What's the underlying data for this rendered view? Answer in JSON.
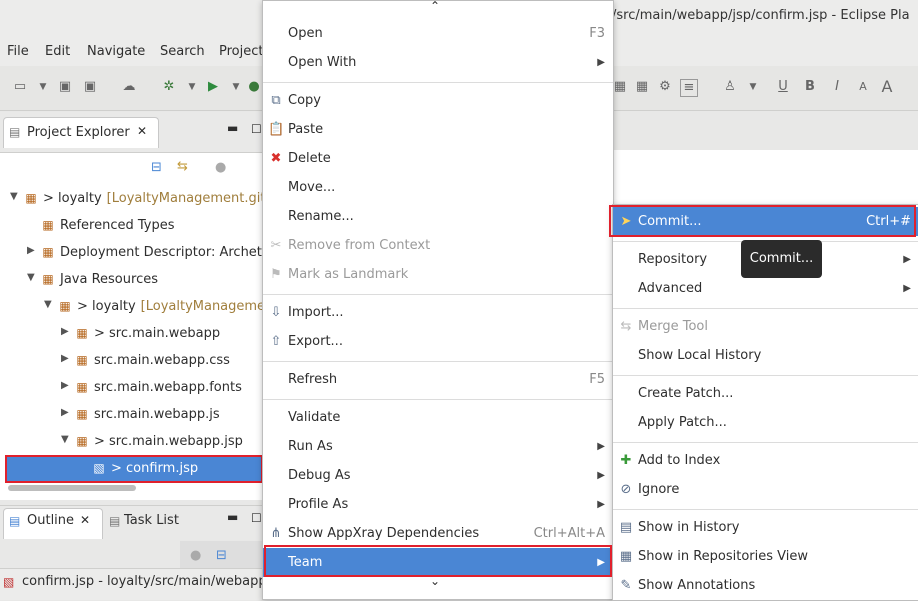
{
  "window": {
    "title": "/src/main/webapp/jsp/confirm.jsp - Eclipse Pla"
  },
  "menubar": [
    "File",
    "Edit",
    "Navigate",
    "Search",
    "Project"
  ],
  "project_explorer": {
    "tab_label": "Project Explorer",
    "tree": [
      {
        "label": "> loyalty",
        "git": "[LoyaltyManagement.git",
        "depth": 0,
        "arrow": "▼"
      },
      {
        "label": "Referenced Types",
        "depth": 1,
        "arrow": ""
      },
      {
        "label": "Deployment Descriptor: Archet",
        "depth": 1,
        "arrow": "▶"
      },
      {
        "label": "Java Resources",
        "depth": 1,
        "arrow": "▼"
      },
      {
        "label": "> loyalty",
        "git": "[LoyaltyManageme",
        "depth": 2,
        "arrow": "▼"
      },
      {
        "label": "> src.main.webapp",
        "depth": 3,
        "arrow": "▶"
      },
      {
        "label": "src.main.webapp.css",
        "depth": 3,
        "arrow": "▶"
      },
      {
        "label": "src.main.webapp.fonts",
        "depth": 3,
        "arrow": "▶"
      },
      {
        "label": "src.main.webapp.js",
        "depth": 3,
        "arrow": "▶"
      },
      {
        "label": "> src.main.webapp.jsp",
        "depth": 3,
        "arrow": "▼"
      },
      {
        "label": "> confirm.jsp",
        "depth": 4,
        "arrow": "",
        "selected": true
      }
    ]
  },
  "bottom_tabs": {
    "outline": "Outline",
    "task_list": "Task List"
  },
  "status": {
    "text": "confirm.jsp - loyalty/src/main/webapp"
  },
  "context_menu": {
    "items": [
      {
        "label": "Open",
        "shortcut": "F3"
      },
      {
        "label": "Open With",
        "submenu": true
      },
      {
        "sep": true
      },
      {
        "label": "Copy",
        "icon": "copy-icon",
        "glyph": "⧉"
      },
      {
        "label": "Paste",
        "icon": "paste-icon",
        "glyph": "📋"
      },
      {
        "label": "Delete",
        "icon": "delete-icon",
        "glyph": "✖",
        "color": "#d9302c"
      },
      {
        "label": "Move..."
      },
      {
        "label": "Rename..."
      },
      {
        "label": "Remove from Context",
        "disabled": true,
        "icon": "remove-context-icon",
        "glyph": "✂"
      },
      {
        "label": "Mark as Landmark",
        "disabled": true,
        "icon": "landmark-icon",
        "glyph": "⚑"
      },
      {
        "sep": true
      },
      {
        "label": "Import...",
        "icon": "import-icon",
        "glyph": "⇩"
      },
      {
        "label": "Export...",
        "icon": "export-icon",
        "glyph": "⇧"
      },
      {
        "sep": true
      },
      {
        "label": "Refresh",
        "shortcut": "F5"
      },
      {
        "sep": true
      },
      {
        "label": "Validate"
      },
      {
        "label": "Run As",
        "submenu": true
      },
      {
        "label": "Debug As",
        "submenu": true
      },
      {
        "label": "Profile As",
        "submenu": true
      },
      {
        "label": "Show AppXray Dependencies",
        "shortcut": "Ctrl+Alt+A",
        "icon": "appxray-icon",
        "glyph": "⋔"
      },
      {
        "label": "Team",
        "submenu": true,
        "highlighted": true
      }
    ]
  },
  "team_menu": {
    "items": [
      {
        "label": "Commit...",
        "shortcut": "Ctrl+#",
        "highlighted": true,
        "icon": "commit-icon",
        "glyph": "➤"
      },
      {
        "sep": true
      },
      {
        "label": "Repository",
        "submenu": true
      },
      {
        "label": "Advanced",
        "submenu": true
      },
      {
        "sep": true
      },
      {
        "label": "Merge Tool",
        "disabled": true,
        "icon": "merge-tool-icon",
        "glyph": "⇆"
      },
      {
        "label": "Show Local History"
      },
      {
        "sep": true
      },
      {
        "label": "Create Patch..."
      },
      {
        "label": "Apply Patch..."
      },
      {
        "sep": true
      },
      {
        "label": "Add to Index",
        "icon": "add-index-icon",
        "glyph": "✚",
        "color": "#3a9a3a"
      },
      {
        "label": "Ignore",
        "icon": "ignore-icon",
        "glyph": "⊘"
      },
      {
        "sep": true
      },
      {
        "label": "Show in History",
        "icon": "history-icon",
        "glyph": "▤"
      },
      {
        "label": "Show in Repositories View",
        "icon": "repositories-icon",
        "glyph": "▦"
      },
      {
        "label": "Show Annotations",
        "icon": "annotations-icon",
        "glyph": "✎"
      }
    ]
  },
  "tooltip": {
    "text": "Commit..."
  },
  "colors": {
    "highlight": "#4a86d4",
    "callout_border": "#e0202c"
  }
}
